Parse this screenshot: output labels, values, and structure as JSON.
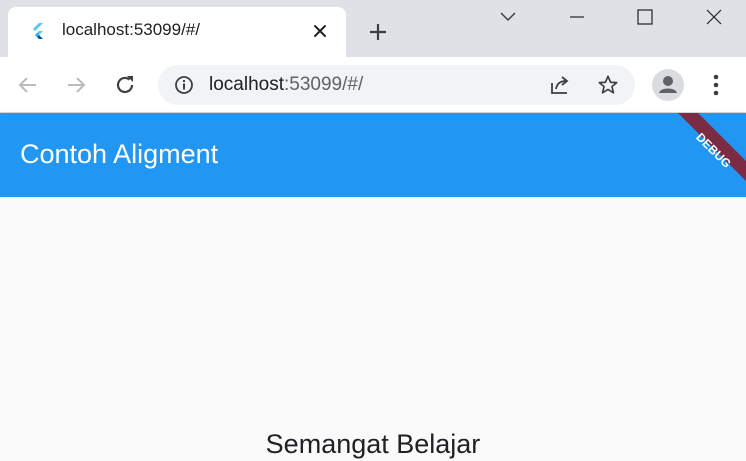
{
  "browser": {
    "tab": {
      "title": "localhost:53099/#/",
      "favicon": "flutter-logo-icon"
    },
    "omnibox": {
      "url_host": "localhost",
      "url_rest": ":53099/#/"
    },
    "colors": {
      "tabstrip": "#dee1e6",
      "toolbar": "#ffffff",
      "omnibox": "#f1f3f4"
    }
  },
  "app": {
    "appbar": {
      "title": "Contoh Aligment",
      "color": "#2196f3"
    },
    "debug_banner": {
      "label": "DEBUG",
      "color": "#7b2c44"
    },
    "body": {
      "text": "Semangat Belajar"
    }
  }
}
